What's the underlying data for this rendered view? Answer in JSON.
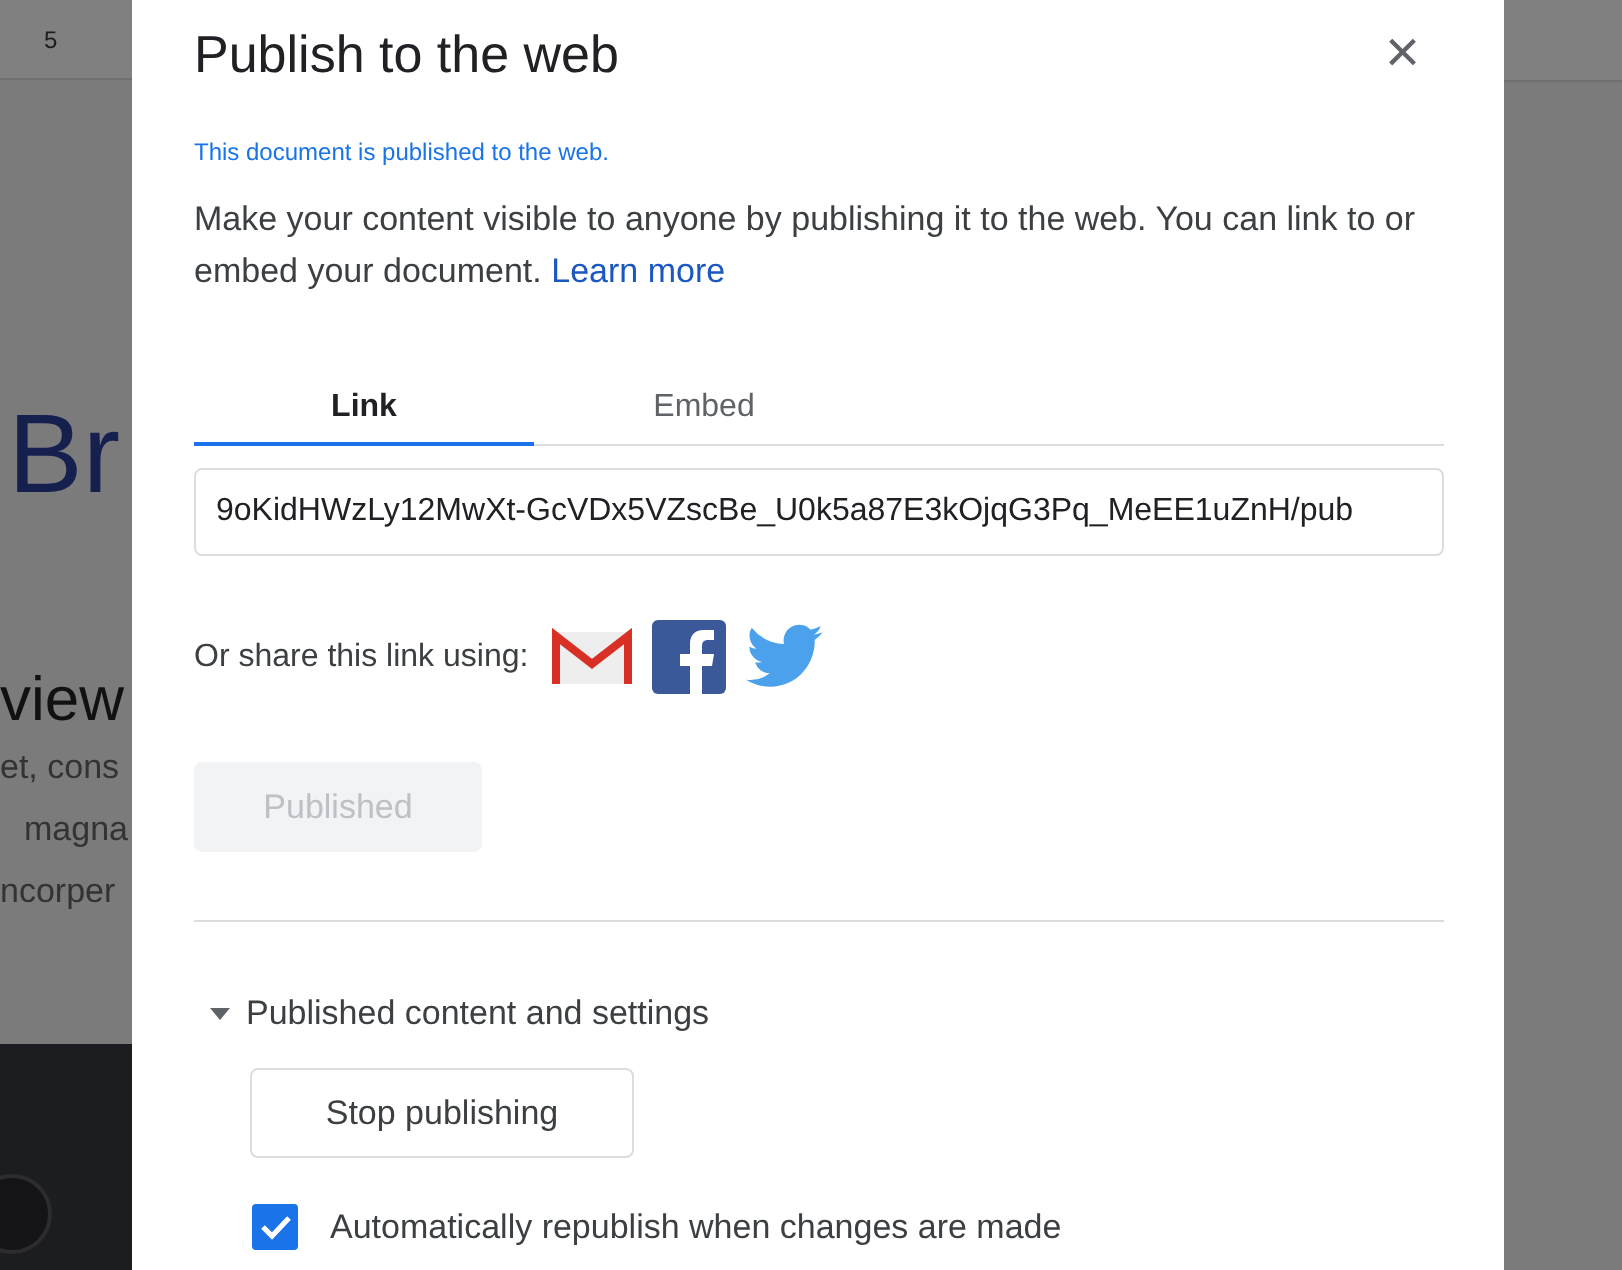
{
  "background_document": {
    "ruler_number": "5",
    "heading": "Br",
    "subheading": "view",
    "lines": [
      "et, cons",
      "magna",
      "ncorper"
    ]
  },
  "dialog": {
    "title": "Publish to the web",
    "close": "×",
    "status": "This document is published to the web.",
    "description": "Make your content visible to anyone by publishing it to the web. You can link to or embed your document.",
    "learn_more": "Learn more",
    "tabs": [
      {
        "label": "Link",
        "selected": true
      },
      {
        "label": "Embed",
        "selected": false
      }
    ],
    "link_value": "9oKidHWzLy12MwXt-GcVDx5VZscBe_U0k5a87E3kOjqG3Pq_MeEE1uZnH/pub",
    "share_label": "Or share this link using:",
    "share_targets": [
      {
        "kind": "mail"
      },
      {
        "kind": "facebook"
      },
      {
        "kind": "bird"
      }
    ],
    "publish_button": {
      "label": "Published",
      "disabled": true
    },
    "settings": {
      "label": "Published content and settings",
      "expanded": true,
      "stop_button": "Stop publishing",
      "auto_republish": {
        "label": "Automatically republish when changes are made",
        "checked": true
      }
    }
  }
}
